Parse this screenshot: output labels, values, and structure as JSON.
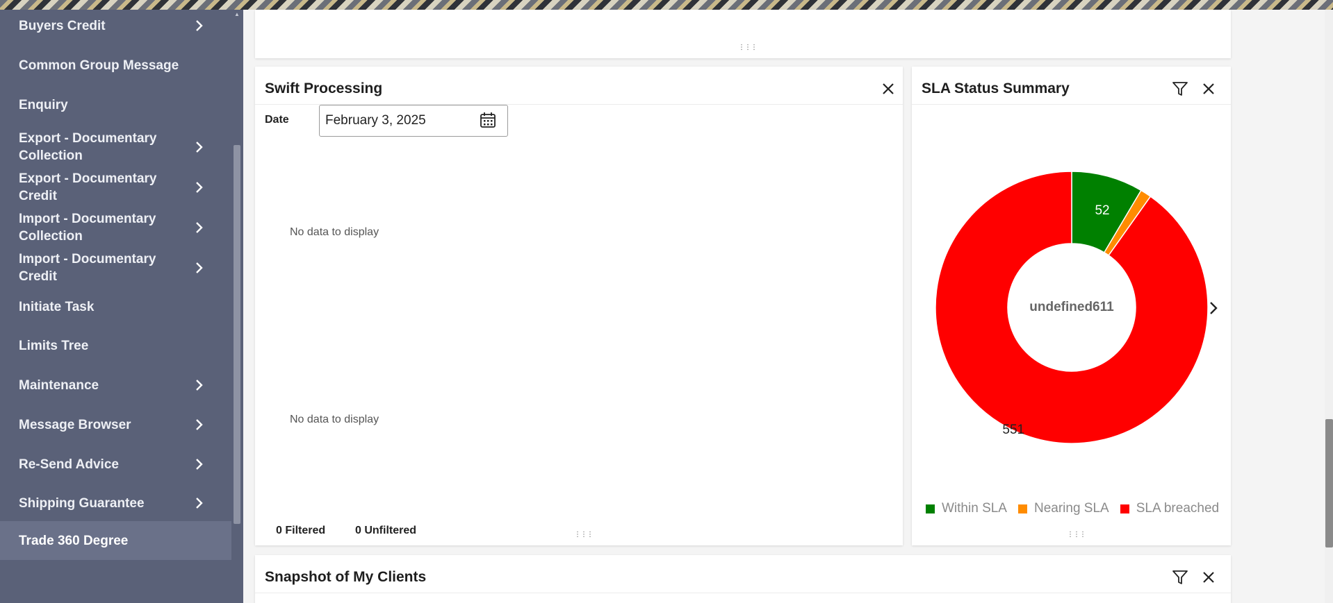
{
  "sidebar": {
    "items": [
      {
        "label": "Buyers Credit",
        "chevron": true
      },
      {
        "label": "Common Group Message",
        "chevron": false
      },
      {
        "label": "Enquiry",
        "chevron": false
      },
      {
        "label": "Export - Documentary Collection",
        "chevron": true
      },
      {
        "label": "Export - Documentary Credit",
        "chevron": true
      },
      {
        "label": "Import - Documentary Collection",
        "chevron": true
      },
      {
        "label": "Import - Documentary Credit",
        "chevron": true
      },
      {
        "label": "Initiate Task",
        "chevron": false
      },
      {
        "label": "Limits Tree",
        "chevron": false
      },
      {
        "label": "Maintenance",
        "chevron": true
      },
      {
        "label": "Message Browser",
        "chevron": true
      },
      {
        "label": "Re-Send Advice",
        "chevron": true
      },
      {
        "label": "Shipping Guarantee",
        "chevron": true
      },
      {
        "label": "Trade 360 Degree",
        "chevron": false,
        "active": true
      }
    ],
    "bg_color": "#5a6178",
    "active_color": "#6a7189"
  },
  "swift": {
    "title": "Swift Processing",
    "date_label": "Date",
    "date_value": "February 3, 2025",
    "no_data_1": "No data to display",
    "no_data_2": "No data to display",
    "filtered": "0 Filtered",
    "unfiltered": "0 Unfiltered"
  },
  "sla": {
    "title": "SLA Status Summary",
    "center_label": "undefined611"
  },
  "snapshot": {
    "title": "Snapshot of My Clients"
  },
  "icons": {
    "close": "close-icon",
    "filter": "filter-icon",
    "calendar": "calendar-icon",
    "chevron": "chevron-right-icon",
    "drag": "drag-handle-icon"
  },
  "chart_data": {
    "type": "pie",
    "title": "SLA Status Summary",
    "donut": true,
    "center_text": "undefined611",
    "categories": [
      "Within SLA",
      "Nearing SLA",
      "SLA breached"
    ],
    "values": [
      52,
      8,
      551
    ],
    "data_labels": [
      "52",
      "",
      "551"
    ],
    "colors": [
      "#008000",
      "#ff8c00",
      "#ff0000"
    ],
    "legend": "bottom"
  }
}
